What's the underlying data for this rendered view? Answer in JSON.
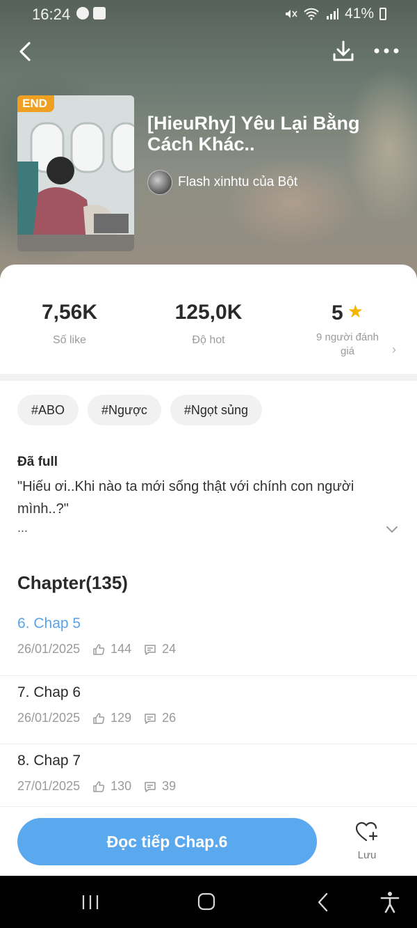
{
  "status_bar": {
    "time": "16:24",
    "battery": "41%"
  },
  "header": {
    "badge": "END",
    "title": "[HieuRhy] Yêu Lại Bằng Cách Khác..",
    "author": "Flash xinhtu của Bột"
  },
  "stats": {
    "likes_value": "7,56K",
    "likes_label": "Số like",
    "hot_value": "125,0K",
    "hot_label": "Độ hot",
    "rating_value": "5",
    "rating_label": "9 người đánh giá"
  },
  "tags": [
    "#ABO",
    "#Ngược",
    "#Ngọt sủng"
  ],
  "description": {
    "status": "Đã full",
    "text": "\"Hiếu ơi..Khi nào ta mới sống thật với chính con người mình..?\"",
    "more": "..."
  },
  "chapters": {
    "heading": "Chapter(135)",
    "items": [
      {
        "name": "6. Chap 5",
        "date": "26/01/2025",
        "likes": "144",
        "comments": "24"
      },
      {
        "name": "7. Chap 6",
        "date": "26/01/2025",
        "likes": "129",
        "comments": "26"
      },
      {
        "name": "8. Chap 7",
        "date": "27/01/2025",
        "likes": "130",
        "comments": "39"
      }
    ]
  },
  "actions": {
    "read_label": "Đọc tiếp Chap.6",
    "save_label": "Lưu"
  },
  "colors": {
    "accent": "#5aa8ee",
    "current_chapter": "#5aa3e8",
    "badge": "#f0a020",
    "star": "#f5b400"
  }
}
